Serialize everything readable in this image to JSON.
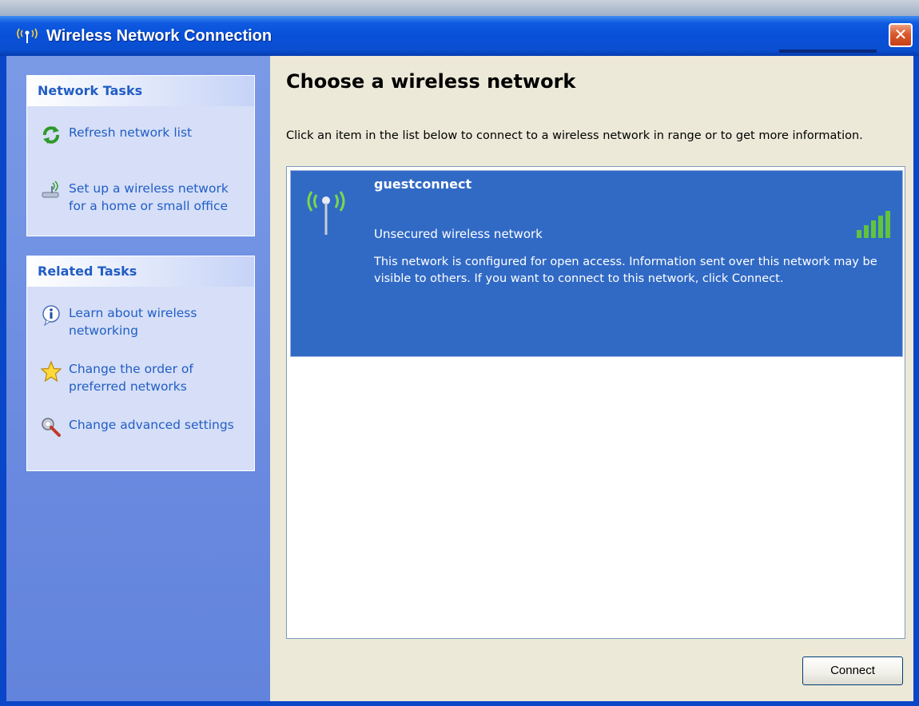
{
  "window": {
    "title": "Wireless Network Connection",
    "close_label": "✕"
  },
  "sidebar": {
    "network_tasks": {
      "heading": "Network Tasks",
      "items": [
        {
          "label": "Refresh network list",
          "icon": "refresh-icon"
        },
        {
          "label": "Set up a wireless network for a home or small office",
          "icon": "setup-wireless-icon"
        }
      ]
    },
    "related_tasks": {
      "heading": "Related Tasks",
      "items": [
        {
          "label": "Learn about wireless networking",
          "icon": "info-icon"
        },
        {
          "label": "Change the order of preferred networks",
          "icon": "star-icon"
        },
        {
          "label": "Change advanced settings",
          "icon": "advanced-settings-icon"
        }
      ]
    }
  },
  "main": {
    "heading": "Choose a wireless network",
    "intro": "Click an item in the list below to connect to a wireless network in range or to get more information.",
    "networks": [
      {
        "name": "guestconnect",
        "security": "Unsecured wireless network",
        "description": "This network is configured for open access. Information sent over this network may be visible to others. If you want to connect to this network, click Connect.",
        "signal_bars": 5,
        "selected": true
      }
    ],
    "connect_label": "Connect"
  },
  "colors": {
    "titlebar": "#0850d8",
    "sidebar": "#6a8ae0",
    "task_link": "#215dc6",
    "selection": "#316ac5",
    "signal": "#62c43c"
  }
}
